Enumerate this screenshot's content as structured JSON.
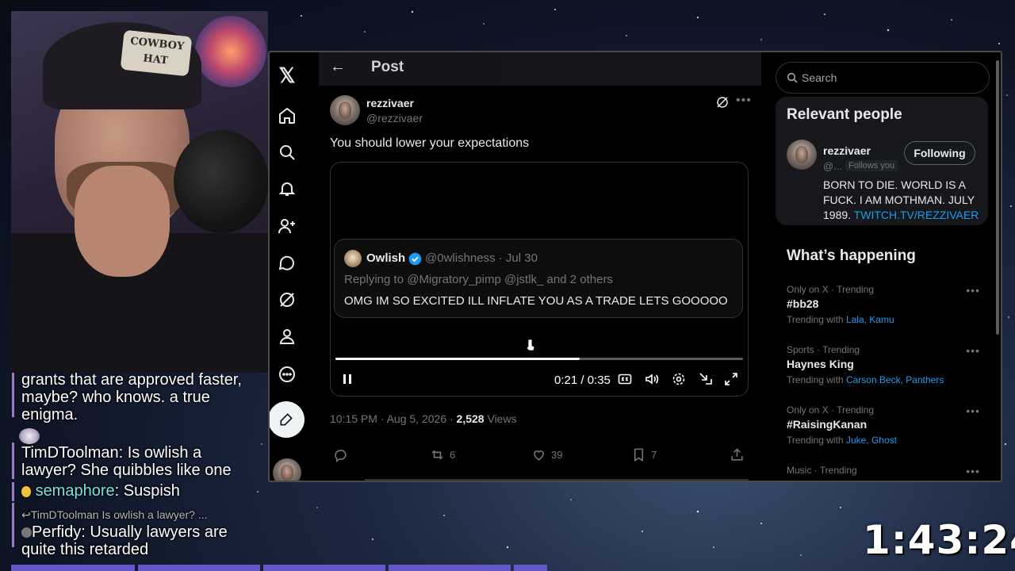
{
  "overlay": {
    "timer": "1:43:24",
    "chat": [
      {
        "user": "",
        "text": "grants that are approved faster, maybe? who knows. a true enigma."
      },
      {
        "user": "TimDToolman",
        "text": "Is owlish a lawyer? She quibbles like one"
      },
      {
        "user": "semaphore",
        "text": "Suspish"
      },
      {
        "reply_to": "TimDToolman Is owlish a lawyer? ..."
      },
      {
        "user": "Perfidy",
        "text": "Usually lawyers are quite this retarded"
      }
    ],
    "webcam_cap_text": "COWBOY HAT",
    "colors": {
      "chat_semaphore": "#7de3d8",
      "strip": "#6657c8"
    }
  },
  "nav": {
    "items": [
      "x-logo",
      "home",
      "explore",
      "notifications",
      "follow",
      "messages",
      "grok",
      "profile",
      "more"
    ]
  },
  "header": {
    "title": "Post"
  },
  "post": {
    "author_name": "rezzivaer",
    "author_handle": "@rezzivaer",
    "text": "You should lower your expectations",
    "quote": {
      "name": "Owlish",
      "handle_date": "@0wlishness · Jul 30",
      "replying": "Replying to @Migratory_pimp @jstlk_ and 2 others",
      "text": "OMG IM SO EXCITED ILL INFLATE YOU AS A TRADE LETS GOOOOO"
    },
    "video": {
      "time": "0:21 / 0:35",
      "progress": 0.6
    },
    "timestamp": "10:15 PM · Aug 5, 2026 · ",
    "views_count": "2,528",
    "views_label": " Views",
    "replies": "",
    "reposts": "6",
    "likes": "39",
    "bookmarks": "7"
  },
  "sidebar": {
    "search_placeholder": "Search",
    "relevant_title": "Relevant people",
    "person": {
      "name": "rezzivaer",
      "handle": "@...",
      "follows_you": "Follows you",
      "button": "Following",
      "bio": "BORN TO DIE. WORLD IS A FUCK. I AM MOTHMAN. JULY 1989. ",
      "bio_link": "TWITCH.TV/REZZIVAER"
    },
    "happening_title": "What’s happening",
    "trends": [
      {
        "cat": "Only on X · Trending",
        "name": "#bb28",
        "with_label": "Trending with ",
        "with": "Lala, Kamu"
      },
      {
        "cat": "Sports · Trending",
        "name": "Haynes King",
        "with_label": "Trending with ",
        "with": "Carson Beck, Panthers"
      },
      {
        "cat": "Only on X · Trending",
        "name": "#RaisingKanan",
        "with_label": "Trending with ",
        "with": "Juke, Ghost"
      },
      {
        "cat": "Music · Trending",
        "name": "",
        "with_label": "",
        "with": ""
      }
    ]
  }
}
